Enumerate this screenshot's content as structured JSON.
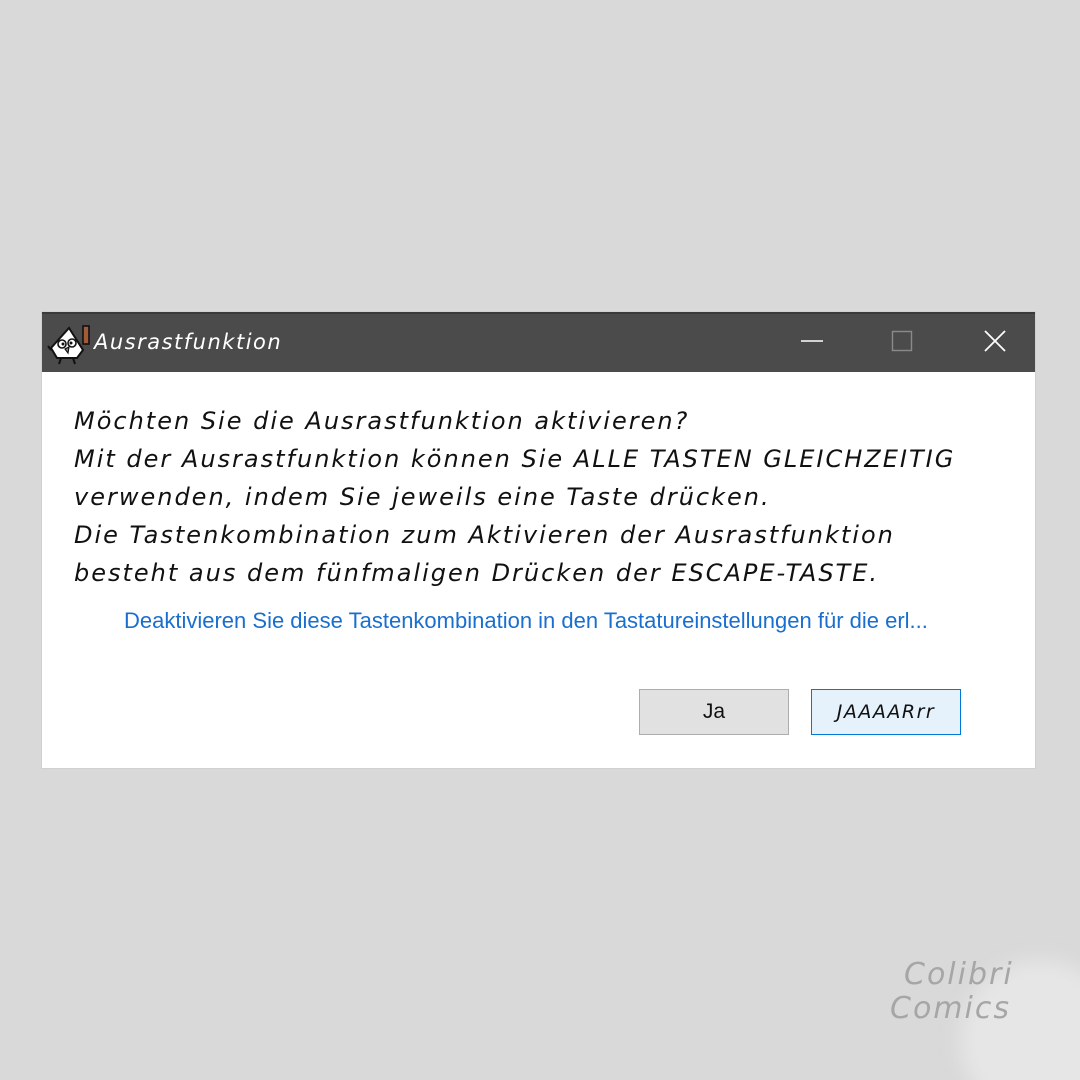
{
  "window": {
    "title": "Ausrastfunktion",
    "icon": "cartoon-bird-character-icon",
    "controls": {
      "minimize_icon": "minimize-icon",
      "maximize_icon": "maximize-icon",
      "close_icon": "close-icon"
    }
  },
  "dialog": {
    "message_lines": [
      "Möchten Sie die Ausrastfunktion aktivieren?",
      "Mit der Ausrastfunktion können Sie ALLE TASTEN GLEICHZEITIG",
      "verwenden, indem Sie jeweils eine Taste drücken.",
      "Die Tastenkombination zum Aktivieren der Ausrastfunktion",
      "besteht aus dem fünfmaligen Drücken der ESCAPE-TASTE."
    ],
    "settings_link": "Deaktivieren Sie diese Tastenkombination in den Tastatureinstellungen für die erl...",
    "buttons": {
      "yes_label": "Ja",
      "alt_yes_label": "JAAAARrr"
    }
  },
  "watermark": {
    "line1": "Colibri",
    "line2": "Comics"
  },
  "colors": {
    "background": "#d9d9d9",
    "titlebar": "#4b4b4b",
    "link": "#1a6fce",
    "focused_button_border": "#0078d7",
    "focused_button_fill": "#e5f1fb"
  }
}
